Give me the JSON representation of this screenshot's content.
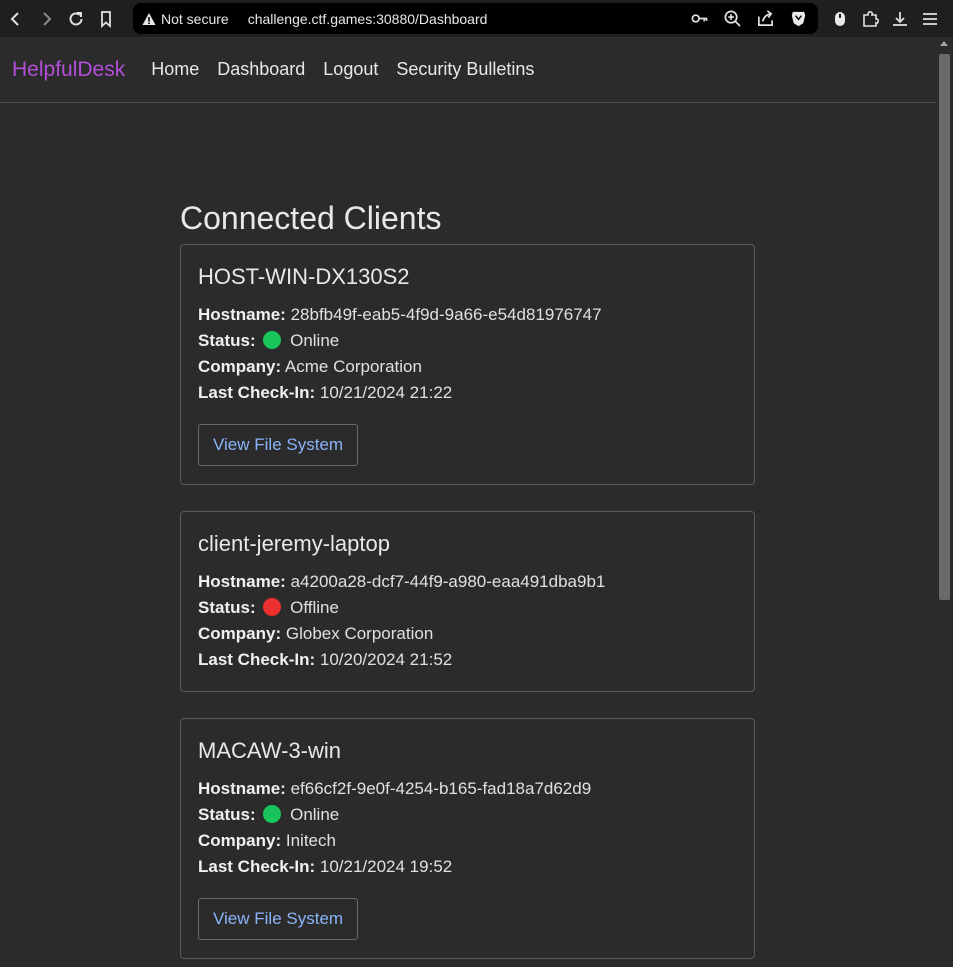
{
  "browser": {
    "not_secure": "Not secure",
    "url": "challenge.ctf.games:30880/Dashboard"
  },
  "nav": {
    "brand": "HelpfulDesk",
    "links": [
      "Home",
      "Dashboard",
      "Logout",
      "Security Bulletins"
    ]
  },
  "main": {
    "title": "Connected Clients",
    "labels": {
      "hostname": "Hostname:",
      "status": "Status:",
      "company": "Company:",
      "last_checkin": "Last Check-In:"
    },
    "clients": [
      {
        "name": "HOST-WIN-DX130S2",
        "hostname": "28bfb49f-eab5-4f9d-9a66-e54d81976747",
        "status": "Online",
        "status_color": "#19c45a",
        "company": "Acme Corporation",
        "last_checkin": "10/21/2024 21:22",
        "button": "View File System"
      },
      {
        "name": "client-jeremy-laptop",
        "hostname": "a4200a28-dcf7-44f9-a980-eaa491dba9b1",
        "status": "Offline",
        "status_color": "#ee2f2f",
        "company": "Globex Corporation",
        "last_checkin": "10/20/2024 21:52"
      },
      {
        "name": "MACAW-3-win",
        "hostname": "ef66cf2f-9e0f-4254-b165-fad18a7d62d9",
        "status": "Online",
        "status_color": "#19c45a",
        "company": "Initech",
        "last_checkin": "10/21/2024 19:52",
        "button": "View File System"
      }
    ]
  }
}
